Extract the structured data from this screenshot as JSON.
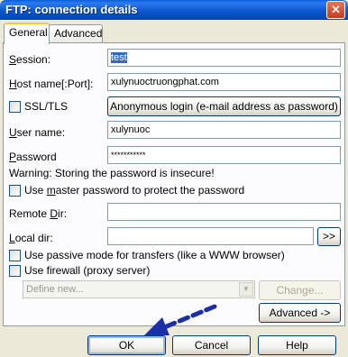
{
  "window": {
    "title": "FTP: connection details",
    "close_glyph": "✕"
  },
  "tabs": [
    {
      "label": "General",
      "active": true
    },
    {
      "label": "Advanced",
      "active": false
    }
  ],
  "form": {
    "session": {
      "label_u": "S",
      "label_rest": "ession:",
      "value": "test"
    },
    "host": {
      "label_u": "H",
      "label_rest": "ost name[:Port]:",
      "value": "xulynuoctruongphat.com"
    },
    "ssl": {
      "label": "SSL/TLS",
      "checked": false
    },
    "anon_button": "Anonymous login (e-mail address as password)",
    "user": {
      "label_u": "U",
      "label_rest": "ser name:",
      "value": "xulynuoc"
    },
    "password": {
      "label_u": "P",
      "label_rest": "assword",
      "value": "***********"
    },
    "warning": "Warning: Storing the password is insecure!",
    "master_pw": {
      "label_pre": "Use ",
      "label_u": "m",
      "label_rest": "aster password to protect the password",
      "checked": false
    },
    "remote_dir": {
      "label_pre": "Remote ",
      "label_u": "D",
      "label_rest": "ir:",
      "value": ""
    },
    "local_dir": {
      "label_u": "L",
      "label_rest": "ocal dir:",
      "value": ""
    },
    "browse_button": ">>",
    "passive": {
      "label": "Use passive mode for transfers (like a WWW browser)",
      "checked": false
    },
    "firewall": {
      "label": "Use firewall (proxy server)",
      "checked": false
    },
    "proxy_select": {
      "value": "Define new..."
    },
    "change_button": "Change...",
    "advanced_button": "Advanced ->"
  },
  "footer": {
    "ok": "OK",
    "cancel": "Cancel",
    "help": "Help"
  },
  "colors": {
    "titlebar": "#0a5fd8",
    "annotation_arrow": "#1c2fa8"
  },
  "icons": {
    "close": "close-icon",
    "combo": "chevron-down-icon",
    "annotation": "pointer-arrow-icon"
  }
}
